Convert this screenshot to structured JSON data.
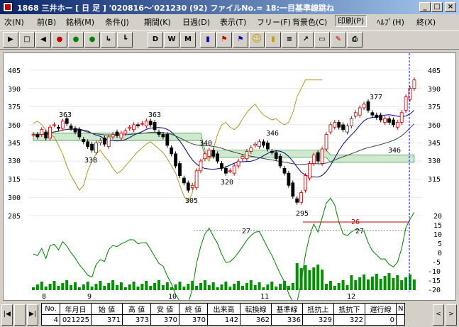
{
  "window": {
    "title": "1868 三井ホー [ 日 足 ]   '020816～'021230 (92)   ファイルNo.= 18:一目基準線跳ね",
    "buttons": {
      "minimize": "_",
      "maximize": "□",
      "close": "×"
    }
  },
  "menu": [
    {
      "label": "次(N)"
    },
    {
      "label": "前(B)"
    },
    {
      "label": "銘柄(M)"
    },
    {
      "label": "条件(J)"
    },
    {
      "label": "期間(K)"
    },
    {
      "label": "日週(D)"
    },
    {
      "label": "表示(T)"
    },
    {
      "label": "フリー(F)"
    },
    {
      "label": "背景色(C)"
    },
    {
      "label": "印刷(P)"
    },
    {
      "label": "ﾍﾙﾌﾟ(H)"
    },
    {
      "label": "終(X)"
    }
  ],
  "toolbar": [
    {
      "name": "play",
      "glyph": "▶"
    },
    {
      "name": "blank",
      "glyph": "□"
    },
    {
      "name": "back",
      "glyph": "◀"
    },
    {
      "name": "signal-1",
      "glyph": "●"
    },
    {
      "name": "signal-2",
      "glyph": "●"
    },
    {
      "name": "signal-3",
      "glyph": "●"
    },
    {
      "name": "step",
      "glyph": "↳"
    },
    {
      "name": "line",
      "glyph": "┗"
    },
    {
      "name": "day",
      "glyph": "D"
    },
    {
      "name": "week",
      "glyph": "W"
    },
    {
      "name": "month",
      "glyph": "M"
    },
    {
      "name": "bars",
      "glyph": "▮"
    },
    {
      "name": "flag-red",
      "glyph": "⚑"
    },
    {
      "name": "flag-blue",
      "glyph": "⚑"
    },
    {
      "name": "smile",
      "glyph": "☺"
    },
    {
      "name": "hist",
      "glyph": "▮"
    },
    {
      "name": "lines",
      "glyph": "≡"
    },
    {
      "name": "arrow",
      "glyph": "↗"
    },
    {
      "name": "ruler",
      "glyph": "▭"
    },
    {
      "name": "erase",
      "glyph": "✎"
    },
    {
      "name": "print",
      "glyph": "⎙"
    }
  ],
  "chart_data": {
    "type": "candlestick",
    "price_axis": [
      "405",
      "390",
      "375",
      "360",
      "345",
      "330",
      "315",
      "300",
      "285"
    ],
    "osc_axis": [
      "20",
      "15",
      "10",
      "5",
      "0",
      "-5",
      "-10",
      "-15",
      "-20"
    ],
    "month_labels": [
      "8",
      "9",
      "10",
      "11",
      "12"
    ],
    "price_annotations": [
      "363",
      "338",
      "363",
      "340",
      "305",
      "320",
      "346",
      "295",
      "377",
      "346"
    ],
    "span_annotations": [
      "27",
      "27",
      "26"
    ],
    "ylim": [
      285,
      405
    ]
  },
  "footer": {
    "headers": [
      "No.",
      "年月日",
      "始 値",
      "高 値",
      "安 値",
      "終 値",
      "出来高",
      "転換線",
      "基準線",
      "抵抗上",
      "抵抗下",
      "遅行線",
      "N"
    ],
    "values": [
      "4",
      "021225",
      "371",
      "373",
      "370",
      "370",
      "142",
      "362",
      "336",
      "329",
      "322",
      "0",
      ""
    ]
  }
}
